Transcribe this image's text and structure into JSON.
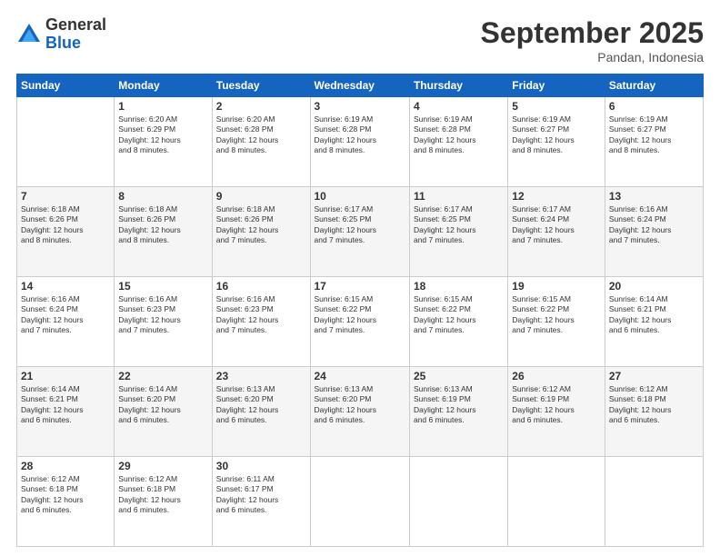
{
  "header": {
    "logo_general": "General",
    "logo_blue": "Blue",
    "month_title": "September 2025",
    "location": "Pandan, Indonesia"
  },
  "days_of_week": [
    "Sunday",
    "Monday",
    "Tuesday",
    "Wednesday",
    "Thursday",
    "Friday",
    "Saturday"
  ],
  "weeks": [
    [
      {
        "day": "",
        "info": ""
      },
      {
        "day": "1",
        "info": "Sunrise: 6:20 AM\nSunset: 6:29 PM\nDaylight: 12 hours\nand 8 minutes."
      },
      {
        "day": "2",
        "info": "Sunrise: 6:20 AM\nSunset: 6:28 PM\nDaylight: 12 hours\nand 8 minutes."
      },
      {
        "day": "3",
        "info": "Sunrise: 6:19 AM\nSunset: 6:28 PM\nDaylight: 12 hours\nand 8 minutes."
      },
      {
        "day": "4",
        "info": "Sunrise: 6:19 AM\nSunset: 6:28 PM\nDaylight: 12 hours\nand 8 minutes."
      },
      {
        "day": "5",
        "info": "Sunrise: 6:19 AM\nSunset: 6:27 PM\nDaylight: 12 hours\nand 8 minutes."
      },
      {
        "day": "6",
        "info": "Sunrise: 6:19 AM\nSunset: 6:27 PM\nDaylight: 12 hours\nand 8 minutes."
      }
    ],
    [
      {
        "day": "7",
        "info": "Sunrise: 6:18 AM\nSunset: 6:26 PM\nDaylight: 12 hours\nand 8 minutes."
      },
      {
        "day": "8",
        "info": "Sunrise: 6:18 AM\nSunset: 6:26 PM\nDaylight: 12 hours\nand 8 minutes."
      },
      {
        "day": "9",
        "info": "Sunrise: 6:18 AM\nSunset: 6:26 PM\nDaylight: 12 hours\nand 7 minutes."
      },
      {
        "day": "10",
        "info": "Sunrise: 6:17 AM\nSunset: 6:25 PM\nDaylight: 12 hours\nand 7 minutes."
      },
      {
        "day": "11",
        "info": "Sunrise: 6:17 AM\nSunset: 6:25 PM\nDaylight: 12 hours\nand 7 minutes."
      },
      {
        "day": "12",
        "info": "Sunrise: 6:17 AM\nSunset: 6:24 PM\nDaylight: 12 hours\nand 7 minutes."
      },
      {
        "day": "13",
        "info": "Sunrise: 6:16 AM\nSunset: 6:24 PM\nDaylight: 12 hours\nand 7 minutes."
      }
    ],
    [
      {
        "day": "14",
        "info": "Sunrise: 6:16 AM\nSunset: 6:24 PM\nDaylight: 12 hours\nand 7 minutes."
      },
      {
        "day": "15",
        "info": "Sunrise: 6:16 AM\nSunset: 6:23 PM\nDaylight: 12 hours\nand 7 minutes."
      },
      {
        "day": "16",
        "info": "Sunrise: 6:16 AM\nSunset: 6:23 PM\nDaylight: 12 hours\nand 7 minutes."
      },
      {
        "day": "17",
        "info": "Sunrise: 6:15 AM\nSunset: 6:22 PM\nDaylight: 12 hours\nand 7 minutes."
      },
      {
        "day": "18",
        "info": "Sunrise: 6:15 AM\nSunset: 6:22 PM\nDaylight: 12 hours\nand 7 minutes."
      },
      {
        "day": "19",
        "info": "Sunrise: 6:15 AM\nSunset: 6:22 PM\nDaylight: 12 hours\nand 7 minutes."
      },
      {
        "day": "20",
        "info": "Sunrise: 6:14 AM\nSunset: 6:21 PM\nDaylight: 12 hours\nand 6 minutes."
      }
    ],
    [
      {
        "day": "21",
        "info": "Sunrise: 6:14 AM\nSunset: 6:21 PM\nDaylight: 12 hours\nand 6 minutes."
      },
      {
        "day": "22",
        "info": "Sunrise: 6:14 AM\nSunset: 6:20 PM\nDaylight: 12 hours\nand 6 minutes."
      },
      {
        "day": "23",
        "info": "Sunrise: 6:13 AM\nSunset: 6:20 PM\nDaylight: 12 hours\nand 6 minutes."
      },
      {
        "day": "24",
        "info": "Sunrise: 6:13 AM\nSunset: 6:20 PM\nDaylight: 12 hours\nand 6 minutes."
      },
      {
        "day": "25",
        "info": "Sunrise: 6:13 AM\nSunset: 6:19 PM\nDaylight: 12 hours\nand 6 minutes."
      },
      {
        "day": "26",
        "info": "Sunrise: 6:12 AM\nSunset: 6:19 PM\nDaylight: 12 hours\nand 6 minutes."
      },
      {
        "day": "27",
        "info": "Sunrise: 6:12 AM\nSunset: 6:18 PM\nDaylight: 12 hours\nand 6 minutes."
      }
    ],
    [
      {
        "day": "28",
        "info": "Sunrise: 6:12 AM\nSunset: 6:18 PM\nDaylight: 12 hours\nand 6 minutes."
      },
      {
        "day": "29",
        "info": "Sunrise: 6:12 AM\nSunset: 6:18 PM\nDaylight: 12 hours\nand 6 minutes."
      },
      {
        "day": "30",
        "info": "Sunrise: 6:11 AM\nSunset: 6:17 PM\nDaylight: 12 hours\nand 6 minutes."
      },
      {
        "day": "",
        "info": ""
      },
      {
        "day": "",
        "info": ""
      },
      {
        "day": "",
        "info": ""
      },
      {
        "day": "",
        "info": ""
      }
    ]
  ]
}
